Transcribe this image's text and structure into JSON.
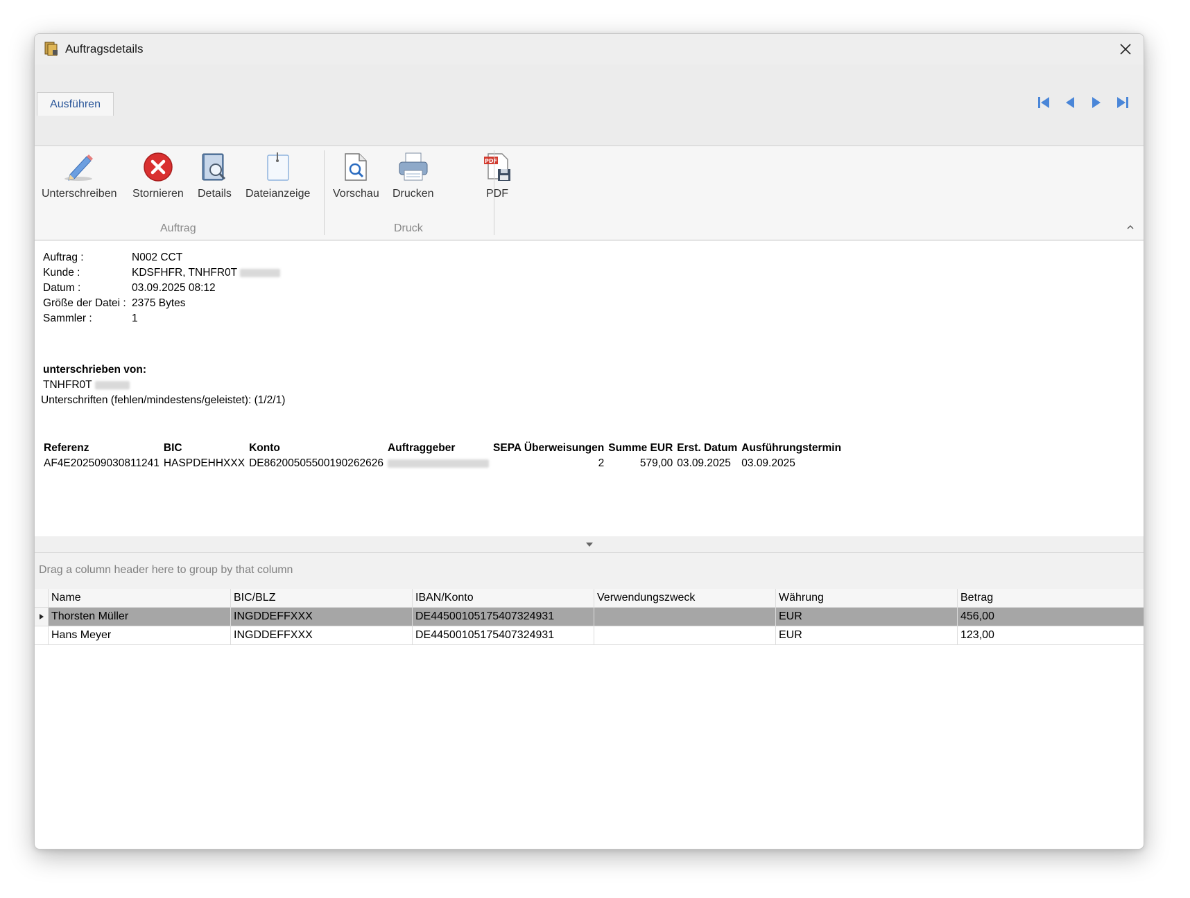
{
  "window": {
    "title": "Auftragsdetails"
  },
  "ribbon": {
    "tab": "Ausführen",
    "groups": [
      {
        "label": "Auftrag",
        "buttons": [
          "Unterschreiben",
          "Stornieren",
          "Details",
          "Dateianzeige"
        ]
      },
      {
        "label": "Druck",
        "buttons": [
          "Vorschau",
          "Drucken",
          "PDF"
        ]
      }
    ]
  },
  "order": {
    "fields": [
      {
        "key": "Auftrag :",
        "value": "N002 CCT"
      },
      {
        "key": "Kunde :",
        "value": "KDSFHFR, TNHFR0T"
      },
      {
        "key": "Datum :",
        "value": "03.09.2025 08:12"
      },
      {
        "key": "Größe der Datei :",
        "value": "2375 Bytes"
      },
      {
        "key": "Sammler :",
        "value": "1"
      }
    ],
    "signed_by_label": "unterschrieben von:",
    "signed_by": "TNHFR0T",
    "signatures": "Unterschriften (fehlen/mindestens/geleistet): (1/2/1)"
  },
  "ref_table": {
    "headers": [
      "Referenz",
      "BIC",
      "Konto",
      "Auftraggeber",
      "SEPA Überweisungen",
      "Summe EUR",
      "Erst. Datum",
      "Ausführungstermin"
    ],
    "row": {
      "referenz": "AF4E202509030811241",
      "bic": "HASPDEHHXXX",
      "konto": "DE86200505500190262626",
      "sepa": "2",
      "summe": "579,00",
      "erst": "03.09.2025",
      "ausf": "03.09.2025"
    }
  },
  "grid": {
    "group_hint": "Drag a column header here to group by that column",
    "headers": [
      "Name",
      "BIC/BLZ",
      "IBAN/Konto",
      "Verwendungszweck",
      "Währung",
      "Betrag"
    ],
    "rows": [
      {
        "name": "Thorsten Müller",
        "bic": "INGDDEFFXXX",
        "iban": "DE44500105175407324931",
        "vz": "",
        "waehrung": "EUR",
        "betrag": "456,00"
      },
      {
        "name": "Hans Meyer",
        "bic": "INGDDEFFXXX",
        "iban": "DE44500105175407324931",
        "vz": "",
        "waehrung": "EUR",
        "betrag": "123,00"
      }
    ]
  },
  "colors": {
    "accent": "#2b579a",
    "nav_arrow": "#4a86d8",
    "selected_row": "#a6a6a6",
    "stop_red": "#d93030"
  }
}
